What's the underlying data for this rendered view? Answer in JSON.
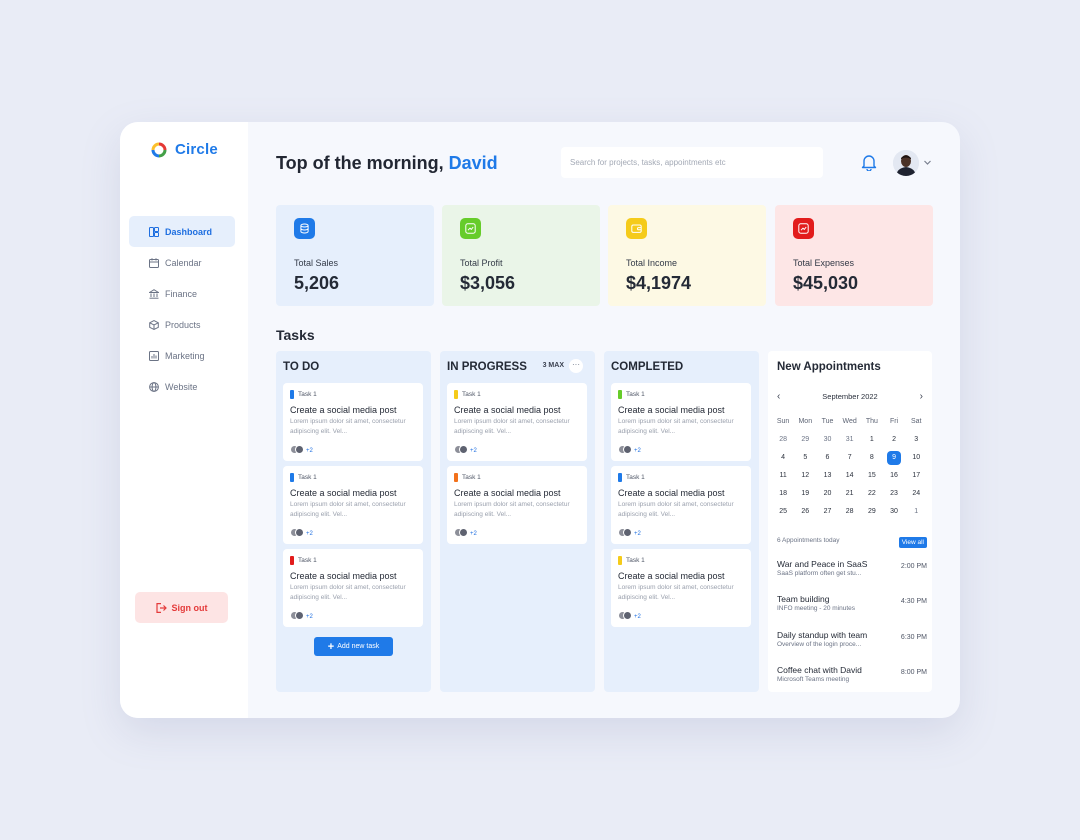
{
  "app": {
    "name": "Circle"
  },
  "sidebar": {
    "items": [
      {
        "label": "Dashboard",
        "icon": "dashboard-icon"
      },
      {
        "label": "Calendar",
        "icon": "calendar-icon"
      },
      {
        "label": "Finance",
        "icon": "bank-icon"
      },
      {
        "label": "Products",
        "icon": "box-icon"
      },
      {
        "label": "Marketing",
        "icon": "chart-icon"
      },
      {
        "label": "Website",
        "icon": "globe-icon"
      }
    ],
    "active": "Dashboard",
    "signout_label": "Sign out"
  },
  "header": {
    "greeting_prefix": "Top of the morning, ",
    "user_name": "David",
    "search_placeholder": "Search for projects, tasks, appointments etc"
  },
  "stats": [
    {
      "label": "Total Sales",
      "value": "5,206",
      "bg": "#e6effc",
      "icon_bg": "#1f7ae8",
      "icon": "database-icon"
    },
    {
      "label": "Total Profit",
      "value": "$3,056",
      "bg": "#eaf5e8",
      "icon_bg": "#66cc2a",
      "icon": "trend-icon"
    },
    {
      "label": "Total Income",
      "value": "$4,1974",
      "bg": "#fdf9e4",
      "icon_bg": "#f5cb1a",
      "icon": "wallet-icon"
    },
    {
      "label": "Total Expenses",
      "value": "$45,030",
      "bg": "#fde6e6",
      "icon_bg": "#e21c1c",
      "icon": "trend-down-icon"
    }
  ],
  "tasks": {
    "title": "Tasks",
    "columns": [
      {
        "title": "TO DO",
        "cards": [
          {
            "tag": "Task 1",
            "color": "#1f7ae8",
            "title": "Create a social media post",
            "desc": "Lorem ipsum dolor sit amet, consectetur adipiscing elit. Vel...",
            "more": "+2"
          },
          {
            "tag": "Task 1",
            "color": "#1f7ae8",
            "title": "Create a social media post",
            "desc": "Lorem ipsum dolor sit amet, consectetur adipiscing elit. Vel...",
            "more": "+2"
          },
          {
            "tag": "Task 1",
            "color": "#e21c1c",
            "title": "Create a social media post",
            "desc": "Lorem ipsum dolor sit amet, consectetur adipiscing elit. Vel...",
            "more": "+2"
          }
        ],
        "add_label": "Add new task"
      },
      {
        "title": "IN PROGRESS",
        "max": "3 MAX",
        "more_icon": "more-icon",
        "cards": [
          {
            "tag": "Task 1",
            "color": "#f5cb1a",
            "title": "Create a social media post",
            "desc": "Lorem ipsum dolor sit amet, consectetur adipiscing elit. Vel...",
            "more": "+2"
          },
          {
            "tag": "Task 1",
            "color": "#f2711c",
            "title": "Create a social media post",
            "desc": "Lorem ipsum dolor sit amet, consectetur adipiscing elit. Vel...",
            "more": "+2"
          }
        ]
      },
      {
        "title": "COMPLETED",
        "cards": [
          {
            "tag": "Task 1",
            "color": "#66cc2a",
            "title": "Create a social media post",
            "desc": "Lorem ipsum dolor sit amet, consectetur adipiscing elit. Vel...",
            "more": "+2"
          },
          {
            "tag": "Task 1",
            "color": "#1f7ae8",
            "title": "Create a social media post",
            "desc": "Lorem ipsum dolor sit amet, consectetur adipiscing elit. Vel...",
            "more": "+2"
          },
          {
            "tag": "Task 1",
            "color": "#f5cb1a",
            "title": "Create a social media post",
            "desc": "Lorem ipsum dolor sit amet, consectetur adipiscing elit. Vel...",
            "more": "+2"
          }
        ]
      }
    ]
  },
  "appointments": {
    "title": "New Appointments",
    "month": "September 2022",
    "weekdays": [
      "Sun",
      "Mon",
      "Tue",
      "Wed",
      "Thu",
      "Fri",
      "Sat"
    ],
    "weeks": [
      [
        "28",
        "29",
        "30",
        "31",
        "1",
        "2",
        "3"
      ],
      [
        "4",
        "5",
        "6",
        "7",
        "8",
        "9",
        "10"
      ],
      [
        "11",
        "12",
        "13",
        "14",
        "15",
        "16",
        "17"
      ],
      [
        "18",
        "19",
        "20",
        "21",
        "22",
        "23",
        "24"
      ],
      [
        "25",
        "26",
        "27",
        "28",
        "29",
        "30",
        "1"
      ]
    ],
    "selected_day": "9",
    "count_label": "6 Appointments today",
    "view_all": "View all",
    "items": [
      {
        "title": "War and Peace in SaaS",
        "subtitle": "SaaS platform often get stu...",
        "time": "2:00 PM"
      },
      {
        "title": "Team building",
        "subtitle": "INFO meeting - 20 minutes",
        "time": "4:30 PM"
      },
      {
        "title": "Daily standup with team",
        "subtitle": "Overview of the login proce...",
        "time": "6:30 PM"
      },
      {
        "title": "Coffee chat with David",
        "subtitle": "Microsoft Teams meeting",
        "time": "8:00 PM"
      }
    ]
  }
}
